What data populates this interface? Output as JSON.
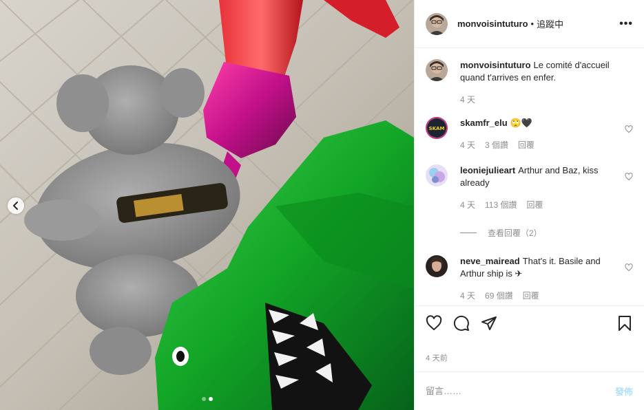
{
  "header": {
    "username": "monvoisintuturo",
    "separator": "•",
    "follow_status": "追蹤中",
    "more_label": "•••"
  },
  "caption": {
    "username": "monvoisintuturo",
    "text": "Le comité d'accueil quand t'arrives en enfer.",
    "age": "4 天"
  },
  "comments": [
    {
      "username": "skamfr_elu",
      "text": "🙄🖤",
      "age": "4 天",
      "likes": "3 個讚",
      "reply": "回覆",
      "avatar_text": "SKAM"
    },
    {
      "username": "leoniejulieart",
      "text": "Arthur and Baz, kiss already",
      "age": "4 天",
      "likes": "113 個讚",
      "reply": "回覆",
      "view_replies": "查看回覆（2）"
    },
    {
      "username": "neve_mairead",
      "text": "That's it. Basile and Arthur ship is ✈",
      "age": "4 天",
      "likes": "69 個讚",
      "reply": "回覆"
    }
  ],
  "post_date": "4 天前",
  "compose": {
    "placeholder": "留言……",
    "post_label": "發佈"
  },
  "carousel": {
    "current": 2,
    "total": 2
  },
  "colors": {
    "accent": "#0095f6",
    "muted": "#8e8e8e",
    "text": "#262626",
    "border": "#efefef"
  },
  "icons": [
    "chevron-left-icon",
    "more-icon",
    "heart-icon",
    "comment-icon",
    "share-icon",
    "bookmark-icon"
  ]
}
